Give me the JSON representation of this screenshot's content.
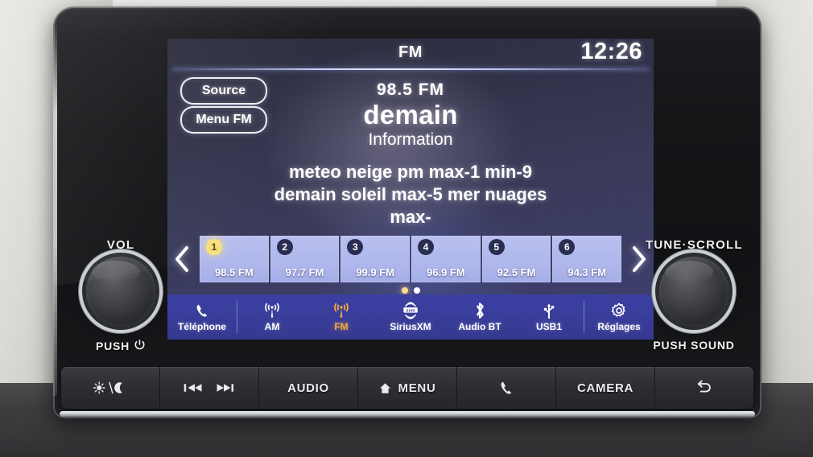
{
  "screen": {
    "status": {
      "title": "FM",
      "clock": "12:26"
    },
    "buttons": {
      "source": "Source",
      "menu_fm": "Menu FM"
    },
    "now_playing": {
      "frequency": "98.5  FM",
      "station": "demain",
      "category": "Information",
      "radiotext_lines": [
        "meteo neige pm max-1 min-9",
        "demain soleil max-5 mer nuages",
        "max-"
      ]
    },
    "presets": {
      "prev_label": "previous-page",
      "next_label": "next-page",
      "items": [
        {
          "number": "1",
          "label": "98.5 FM",
          "active": true
        },
        {
          "number": "2",
          "label": "97.7 FM",
          "active": false
        },
        {
          "number": "3",
          "label": "99.9 FM",
          "active": false
        },
        {
          "number": "4",
          "label": "96.9 FM",
          "active": false
        },
        {
          "number": "5",
          "label": "92.5 FM",
          "active": false
        },
        {
          "number": "6",
          "label": "94.3 FM",
          "active": false
        }
      ],
      "page_dots": 2,
      "active_page": 1
    },
    "source_bar": [
      {
        "label": "Téléphone",
        "icon": "phone-icon",
        "active": false
      },
      {
        "label": "AM",
        "icon": "antenna-icon",
        "active": false
      },
      {
        "label": "FM",
        "icon": "antenna-icon",
        "active": true
      },
      {
        "label": "SiriusXM",
        "icon": "siriusxm-icon",
        "active": false
      },
      {
        "label": "Audio BT",
        "icon": "bluetooth-icon",
        "active": false
      },
      {
        "label": "USB1",
        "icon": "usb-icon",
        "active": false
      },
      {
        "label": "Réglages",
        "icon": "gear-icon",
        "active": false
      }
    ],
    "colors": {
      "accent": "#f7a93c",
      "preset_tile": "#b0b8ec",
      "preset_active_badge": "#f7e07a",
      "source_bar": "#3a3e9c"
    }
  },
  "hardware": {
    "knob_left": {
      "top_label": "VOL",
      "bottom_label": "PUSH",
      "bottom_icon": "power-icon"
    },
    "knob_right": {
      "top_label": "TUNE·SCROLL",
      "bottom_label": "PUSH SOUND",
      "bottom_icon": ""
    },
    "buttons": [
      {
        "label": "",
        "icon": "brightness-day-night-icon"
      },
      {
        "label": "",
        "icon": "prev-next-track-icon"
      },
      {
        "label": "AUDIO",
        "icon": ""
      },
      {
        "label": "MENU",
        "icon": "home-icon"
      },
      {
        "label": "",
        "icon": "phone-icon"
      },
      {
        "label": "CAMERA",
        "icon": ""
      },
      {
        "label": "",
        "icon": "back-icon"
      }
    ]
  }
}
